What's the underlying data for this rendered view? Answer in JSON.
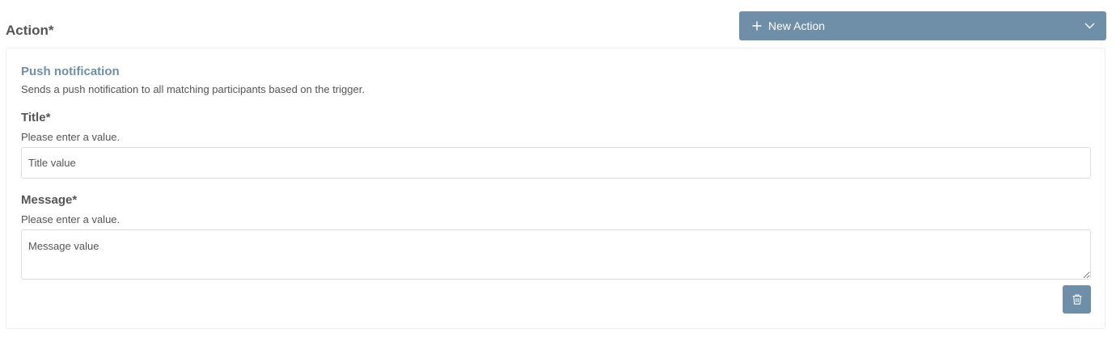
{
  "section": {
    "title": "Action*"
  },
  "new_action_button": {
    "label": "New Action",
    "icon": "plus-icon",
    "dropdown_icon": "chevron-down-icon"
  },
  "action": {
    "name": "Push notification",
    "description": "Sends a push notification to all matching participants based on the trigger.",
    "fields": {
      "title": {
        "label": "Title*",
        "help": "Please enter a value.",
        "value": "Title value"
      },
      "message": {
        "label": "Message*",
        "help": "Please enter a value.",
        "value": "Message value"
      }
    },
    "delete_icon": "trash-icon"
  },
  "colors": {
    "accent": "#6f8fa9",
    "text": "#555555",
    "border": "#dddddd"
  }
}
